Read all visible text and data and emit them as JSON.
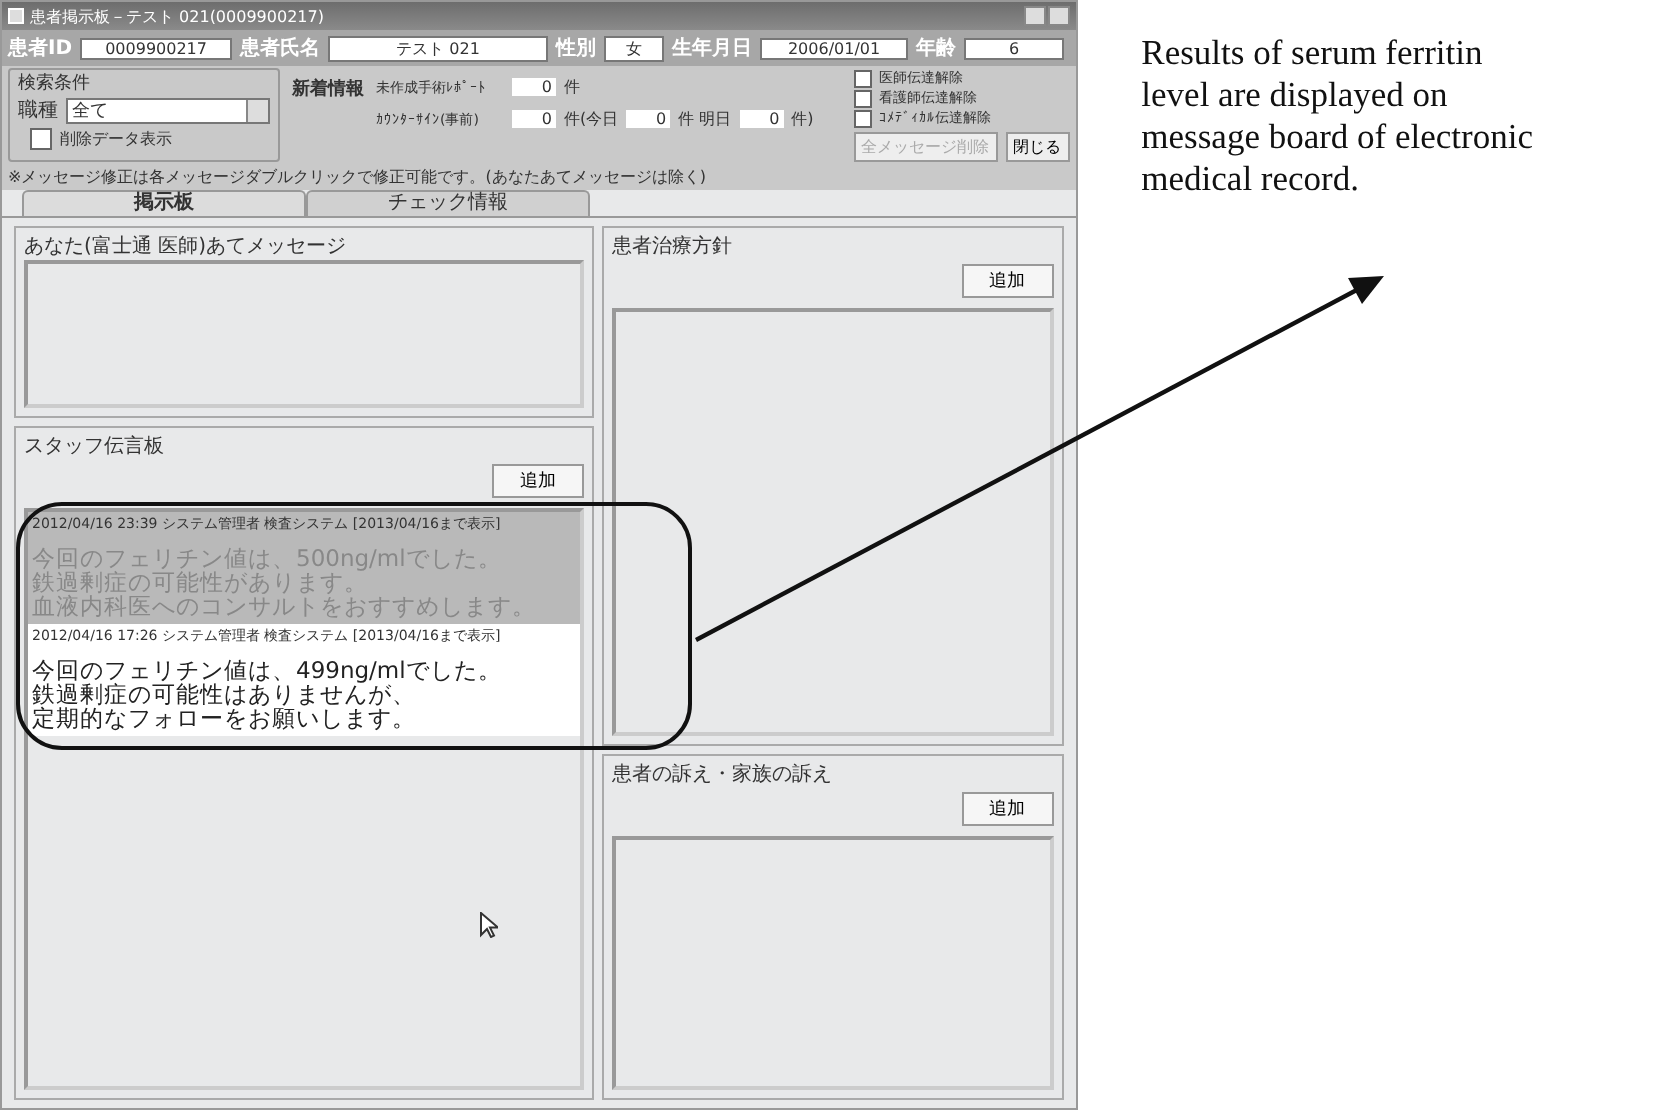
{
  "window": {
    "title": "患者掲示板－テスト 021(0009900217)"
  },
  "patient": [
    {
      "label": "患者ID",
      "value": "0009900217"
    },
    {
      "label": "患者氏名",
      "value": "テスト 021"
    },
    {
      "label": "性別",
      "value": "女"
    },
    {
      "label": "生年月日",
      "value": "2006/01/01"
    },
    {
      "label": "年齢",
      "value": "6"
    }
  ],
  "search": {
    "title": "検索条件",
    "job_label": "職種",
    "job_value": "全て",
    "show_deleted": {
      "label": "削除データ表示",
      "checked": false
    }
  },
  "news": {
    "title": "新着情報",
    "rows": [
      {
        "label": "未作成手術ﾚﾎﾟｰﾄ",
        "parts": [
          {
            "value": "0",
            "suffix": "件"
          }
        ]
      },
      {
        "label": "ｶｳﾝﾀｰｻｲﾝ(事前)",
        "parts": [
          {
            "value": "0",
            "suffix": "件(今日"
          },
          {
            "value": "0",
            "suffix": "件 明日"
          },
          {
            "value": "0",
            "suffix": "件)"
          }
        ]
      }
    ]
  },
  "release_options": [
    {
      "label": "医師伝達解除",
      "checked": false
    },
    {
      "label": "看護師伝達解除",
      "checked": false
    },
    {
      "label": "ｺﾒﾃﾞｨｶﾙ伝達解除",
      "checked": false
    }
  ],
  "buttons": [
    {
      "label": "全メッセージ削除",
      "disabled": true
    },
    {
      "label": "閉じる",
      "disabled": false
    }
  ],
  "note": "※メッセージ修正は各メッセージダブルクリックで修正可能です。(あなたあてメッセージは除く)",
  "tabs": [
    {
      "label": "掲示板",
      "selected": true
    },
    {
      "label": "チェック情報",
      "selected": false
    }
  ],
  "my_messages": {
    "title": "あなた(富士通 医師)あてメッセージ"
  },
  "staff_board": {
    "title": "スタッフ伝言板",
    "add": "追加",
    "messages": [
      {
        "header": "2012/04/16 23:39 システム管理者 検査システム [2013/04/16まで表示]",
        "lines": [
          "今回のフェリチン値は、500ng/mlでした。",
          "鉄過剰症の可能性があります。",
          "血液内科医へのコンサルトをおすすめします。"
        ],
        "selected": true
      },
      {
        "header": "2012/04/16 17:26 システム管理者 検査システム [2013/04/16まで表示]",
        "lines": [
          "今回のフェリチン値は、499ng/mlでした。",
          "鉄過剰症の可能性はありませんが、",
          "定期的なフォローをお願いします。"
        ],
        "selected": false
      }
    ]
  },
  "treatment_policy": {
    "title": "患者治療方針",
    "add": "追加"
  },
  "complaints": {
    "title": "患者の訴え・家族の訴え",
    "add": "追加"
  },
  "annotation": {
    "lines": [
      "Results of serum ferritin",
      "level are displayed on",
      "message board of electronic",
      "medical record."
    ]
  }
}
